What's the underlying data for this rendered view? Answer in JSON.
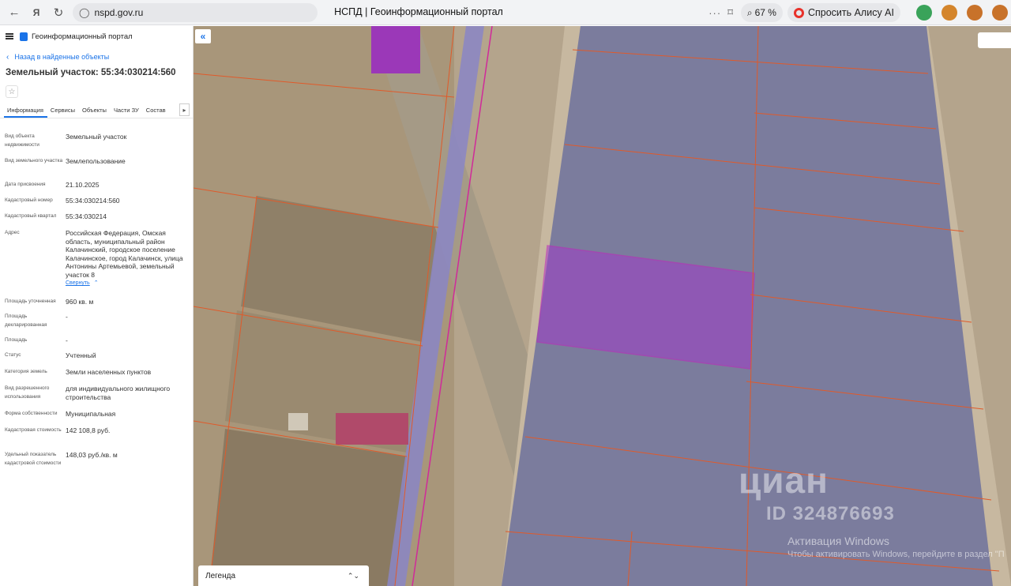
{
  "browser": {
    "url": "nspd.gov.ru",
    "tab_title": "НСПД | Геоинформационный портал",
    "zoom": "67 %",
    "alice_label": "Спросить Алису AI",
    "menu_dots": "···"
  },
  "panel": {
    "portal_title": "Геоинформационный портал",
    "back_label": "Назад в найденные объекты",
    "object_title": "Земельный участок: 55:34:030214:560",
    "tabs": [
      {
        "label": "Информация",
        "active": true
      },
      {
        "label": "Сервисы"
      },
      {
        "label": "Объекты"
      },
      {
        "label": "Части ЗУ"
      },
      {
        "label": "Состав"
      }
    ],
    "collapse_label": "Свернуть",
    "rows": [
      {
        "label": "Вид объекта недвижимости",
        "value": "Земельный участок"
      },
      {
        "label": "Вид земельного участка",
        "value": "Землепользование"
      },
      {
        "label": "Дата присвоения",
        "value": "21.10.2025"
      },
      {
        "label": "Кадастровый номер",
        "value": "55:34:030214:560"
      },
      {
        "label": "Кадастровый квартал",
        "value": "55:34:030214"
      },
      {
        "label": "Адрес",
        "value": "Российская Федерация, Омская область, муниципальный район Калачинский, городское поселение Калачинское, город Калачинск, улица Антонины Артемьевой, земельный участок 8"
      },
      {
        "label": "Площадь уточненная",
        "value": "960 кв. м"
      },
      {
        "label": "Площадь декларированная",
        "value": "-"
      },
      {
        "label": "Площадь",
        "value": "-"
      },
      {
        "label": "Статус",
        "value": "Учтенный"
      },
      {
        "label": "Категория земель",
        "value": "Земли населенных пунктов"
      },
      {
        "label": "Вид разрешенного использования",
        "value": "для индивидуального жилищного строительства"
      },
      {
        "label": "Форма собственности",
        "value": "Муниципальная"
      },
      {
        "label": "Кадастровая стоимость",
        "value": "142 108,8 руб."
      },
      {
        "label": "Удельный показатель кадастровой стоимости",
        "value": "148,03 руб./кв. м"
      }
    ]
  },
  "map": {
    "collapse_icon": "«",
    "legend_label": "Легенда",
    "legend_arrow": "⌃⌄",
    "watermark_logo": "циан",
    "watermark_id": "ID 324876693",
    "activation_title": "Активация Windows",
    "activation_text": "Чтобы активировать Windows, перейдите в раздел \"П",
    "colors": {
      "parcel_fill": "#a03cc8",
      "zone_fill": "#3c4a9a",
      "boundary": "#e05a2a"
    }
  }
}
